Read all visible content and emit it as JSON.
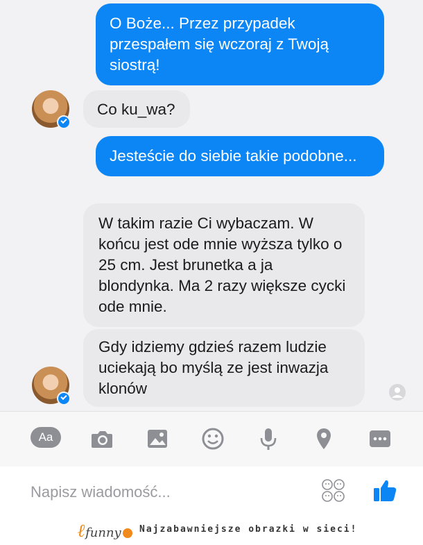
{
  "messages": [
    {
      "dir": "out",
      "text": "O Boże... Przez przypadek przespałem się wczoraj z Twoją siostrą!"
    },
    {
      "dir": "in",
      "text": "Co ku_wa?"
    },
    {
      "dir": "out",
      "text": "Jesteście do siebie takie podobne..."
    },
    {
      "dir": "in",
      "text": "W takim razie Ci wybaczam. W końcu jest ode mnie wyższa tylko o 25 cm. Jest brunetka a ja blondynka. Ma 2 razy większe cycki ode mnie."
    },
    {
      "dir": "in",
      "text": "Gdy idziemy gdzieś razem ludzie uciekają bo myślą ze jest inwazja klonów"
    }
  ],
  "composer": {
    "aa_label": "Aa",
    "placeholder": "Napisz wiadomość...",
    "icons": [
      "text-format-icon",
      "camera-icon",
      "image-icon",
      "emoji-icon",
      "microphone-icon",
      "location-pin-icon",
      "more-icon",
      "sticker-faces-icon",
      "thumbs-up-icon"
    ]
  },
  "colors": {
    "outgoing_bubble": "#0b86f4",
    "incoming_bubble": "#e9e9eb",
    "chat_background": "#f2f2f4",
    "brand_orange": "#f08a1c"
  },
  "footer": {
    "logo_text": "funny",
    "tagline": "Najzabawniejsze obrazki w sieci!"
  }
}
